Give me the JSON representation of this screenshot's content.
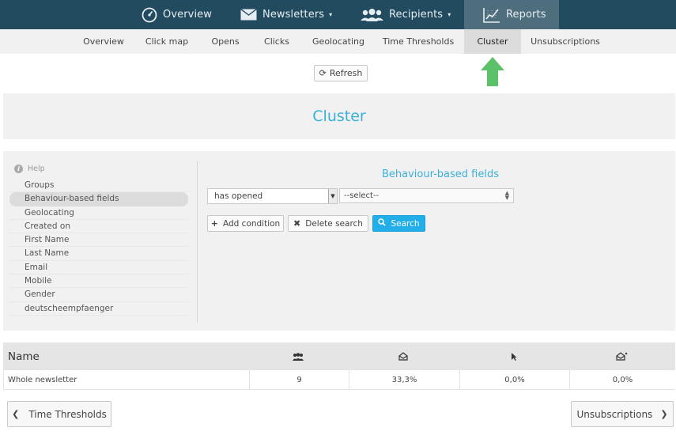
{
  "topnav": {
    "items": [
      {
        "label": "Overview",
        "icon": "dashboard-icon"
      },
      {
        "label": "Newsletters",
        "icon": "envelope-icon",
        "caret": "▾"
      },
      {
        "label": "Recipients",
        "icon": "users-icon",
        "caret": "▾"
      },
      {
        "label": "Reports",
        "icon": "chart-icon"
      }
    ],
    "active": "Reports"
  },
  "subnav": {
    "items": [
      "Overview",
      "Click map",
      "Opens",
      "Clicks",
      "Geolocating",
      "Time Thresholds",
      "Cluster",
      "Unsubscriptions"
    ],
    "active": "Cluster"
  },
  "refresh_label": "Refresh",
  "page_title": "Cluster",
  "help_label": "Help",
  "fields": [
    "Groups",
    "Behaviour-based fields",
    "Geolocating",
    "Created on",
    "First Name",
    "Last Name",
    "Email",
    "Mobile",
    "Gender",
    "deutscheempfaenger"
  ],
  "active_field": "Behaviour-based fields",
  "section_heading": "Behaviour-based fields",
  "condition_select": {
    "value": "has opened"
  },
  "value_select": {
    "value": "--select--"
  },
  "buttons": {
    "add_condition": "Add condition",
    "delete_search": "Delete search",
    "search": "Search"
  },
  "table": {
    "header_name": "Name",
    "columns_icons": [
      "recipients-icon",
      "opened-envelope-icon",
      "cursor-icon",
      "unsubscribe-envelope-icon"
    ],
    "rows": [
      {
        "name": "Whole newsletter",
        "recipients": "9",
        "opens": "33,3%",
        "clicks": "0,0%",
        "unsubscriptions": "0,0%"
      }
    ]
  },
  "pager": {
    "prev_label": "Time Thresholds",
    "next_label": "Unsubscriptions"
  },
  "colors": {
    "topnav_bg": "#234b5f",
    "accent": "#3bb0d9",
    "primary_button": "#21aee9",
    "arrow": "#5cc26a"
  }
}
